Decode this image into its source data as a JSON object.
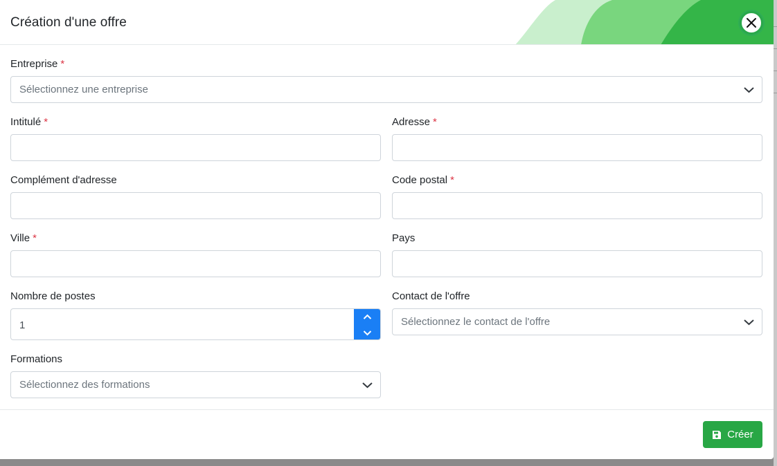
{
  "modal": {
    "title": "Création d'une offre",
    "close_icon": "close-icon"
  },
  "form": {
    "required_marker": "*",
    "entreprise": {
      "label": "Entreprise",
      "placeholder": "Sélectionnez une entreprise"
    },
    "intitule": {
      "label": "Intitulé",
      "value": ""
    },
    "adresse": {
      "label": "Adresse",
      "value": ""
    },
    "complement": {
      "label": "Complément d'adresse",
      "value": ""
    },
    "code_postal": {
      "label": "Code postal",
      "value": ""
    },
    "ville": {
      "label": "Ville",
      "value": ""
    },
    "pays": {
      "label": "Pays",
      "value": ""
    },
    "nombre_postes": {
      "label": "Nombre de postes",
      "value": "1"
    },
    "contact": {
      "label": "Contact de l'offre",
      "placeholder": "Sélectionnez le contact de l'offre"
    },
    "formations": {
      "label": "Formations",
      "placeholder": "Sélectionnez des formations"
    }
  },
  "footer": {
    "create_label": "Créer",
    "create_icon": "save-icon"
  },
  "colors": {
    "primary_green": "#28a745",
    "spinner_blue": "#1a7ff5",
    "required_red": "#dc3545"
  }
}
